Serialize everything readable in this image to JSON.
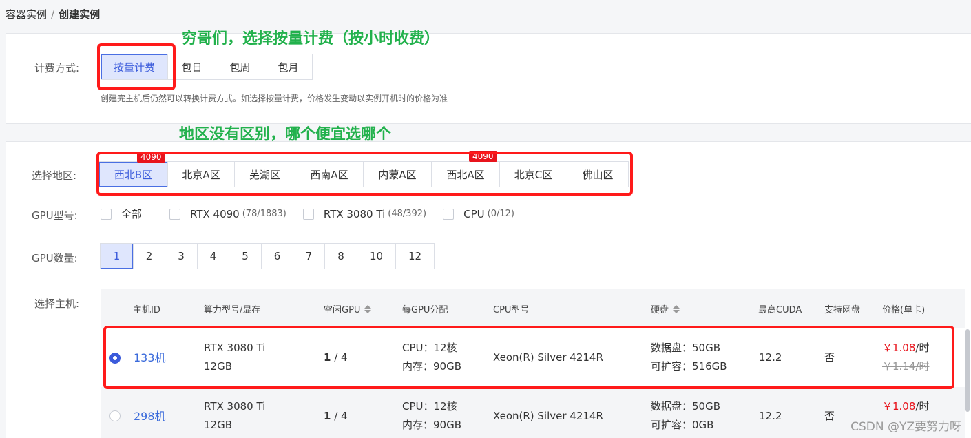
{
  "breadcrumb": {
    "root": "容器实例",
    "sep": "/",
    "current": "创建实例"
  },
  "annotations": {
    "billing": "穷哥们，选择按量计费（按小时收费）",
    "region": "地区没有区别，哪个便宜选哪个"
  },
  "billing": {
    "label": "计费方式:",
    "options": [
      "按量计费",
      "包日",
      "包周",
      "包月"
    ],
    "selected": "按量计费",
    "hint": "创建完主机后仍然可以转换计费方式。如选择按量计费，价格发生变动以实例开机时的价格为准"
  },
  "region": {
    "label": "选择地区:",
    "options": [
      {
        "name": "西北B区",
        "badge": "4090"
      },
      {
        "name": "北京A区",
        "badge": ""
      },
      {
        "name": "芜湖区",
        "badge": ""
      },
      {
        "name": "西南A区",
        "badge": ""
      },
      {
        "name": "内蒙A区",
        "badge": ""
      },
      {
        "name": "西北A区",
        "badge": "4090"
      },
      {
        "name": "北京C区",
        "badge": ""
      },
      {
        "name": "佛山区",
        "badge": ""
      }
    ],
    "selected": "西北B区"
  },
  "gpu_model": {
    "label": "GPU型号:",
    "options": [
      {
        "name": "全部",
        "count": ""
      },
      {
        "name": "RTX 4090",
        "count": "(78/1883)"
      },
      {
        "name": "RTX 3080 Ti",
        "count": "(48/392)"
      },
      {
        "name": "CPU",
        "count": "(0/12)"
      }
    ]
  },
  "gpu_count": {
    "label": "GPU数量:",
    "options": [
      "1",
      "2",
      "3",
      "4",
      "5",
      "6",
      "7",
      "8",
      "10",
      "12"
    ],
    "selected": "1"
  },
  "host": {
    "label": "选择主机:",
    "columns": [
      "主机ID",
      "算力型号/显存",
      "空闲GPU",
      "每GPU分配",
      "CPU型号",
      "硬盘",
      "最高CUDA",
      "支持网盘",
      "价格(单卡)"
    ],
    "rows": [
      {
        "selected": true,
        "id": "133机",
        "model": "RTX 3080 Ti",
        "vram": "12GB",
        "free_gpu": "1",
        "total_gpu": " / 4",
        "cpu_alloc": "CPU：12核",
        "mem_alloc": "内存：90GB",
        "cpu_model": "Xeon(R) Silver 4214R",
        "disk_data": "数据盘：50GB",
        "disk_ext": "可扩容：516GB",
        "cuda": "12.2",
        "netdisk": "否",
        "price_now": "￥1.08",
        "price_unit": "/时",
        "price_old": "￥1.14/时"
      },
      {
        "selected": false,
        "id": "298机",
        "model": "RTX 3080 Ti",
        "vram": "12GB",
        "free_gpu": "1",
        "total_gpu": " / 4",
        "cpu_alloc": "CPU：12核",
        "mem_alloc": "内存：90GB",
        "cpu_model": "Xeon(R) Silver 4214R",
        "disk_data": "数据盘：50GB",
        "disk_ext": "可扩容：0GB",
        "cuda": "12.2",
        "netdisk": "否",
        "price_now": "￥1.08",
        "price_unit": "/时",
        "price_old": ""
      }
    ]
  },
  "watermark": "CSDN @YZ要努力呀",
  "colors": {
    "accent": "#3b5bdb",
    "annotation": "#22b14c",
    "highlight": "#ff1a1a",
    "price": "#e8141c"
  }
}
